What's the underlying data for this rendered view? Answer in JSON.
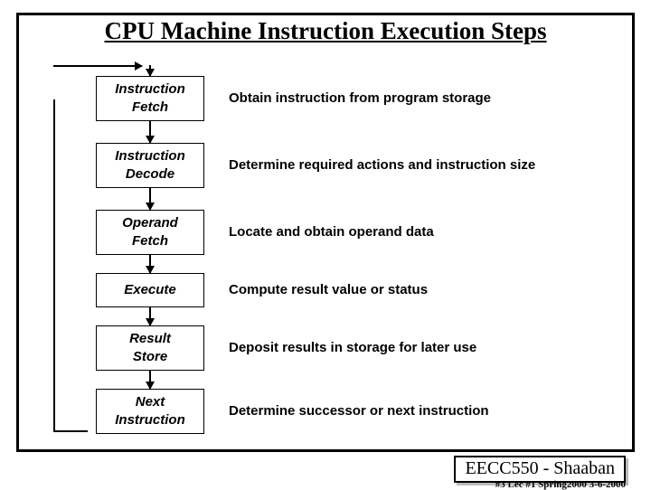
{
  "title": "CPU Machine Instruction Execution Steps",
  "steps": [
    {
      "name": "Instruction\nFetch",
      "desc": "Obtain instruction from program storage"
    },
    {
      "name": "Instruction\nDecode",
      "desc": "Determine required actions and instruction size"
    },
    {
      "name": "Operand\nFetch",
      "desc": "Locate and obtain operand data"
    },
    {
      "name": "Execute",
      "desc": "Compute result value or status"
    },
    {
      "name": "Result\nStore",
      "desc": "Deposit results in storage for later use"
    },
    {
      "name": "Next\nInstruction",
      "desc": "Determine successor or next instruction"
    }
  ],
  "footer": "EECC550 - Shaaban",
  "footnote": "#3   Lec #1   Spring2000   3-6-2000"
}
